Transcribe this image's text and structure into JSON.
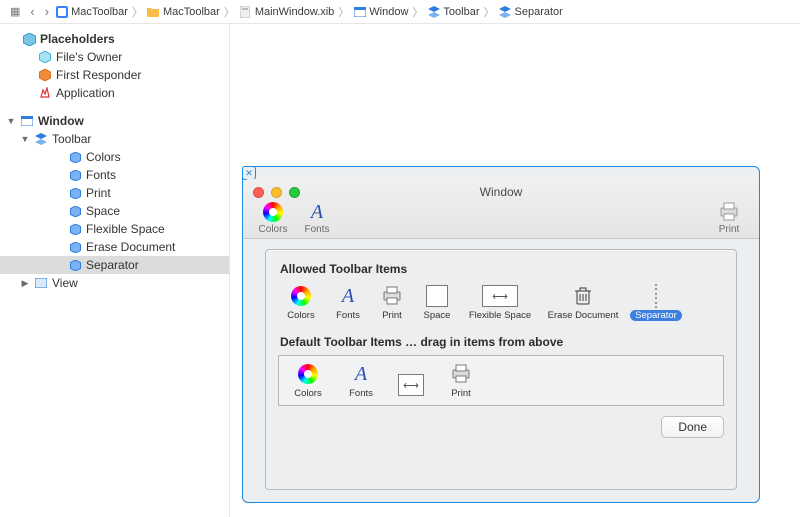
{
  "breadcrumb": [
    {
      "icon": "proj",
      "label": "MacToolbar"
    },
    {
      "icon": "folder",
      "label": "MacToolbar"
    },
    {
      "icon": "xib",
      "label": "MainWindow.xib"
    },
    {
      "icon": "window",
      "label": "Window"
    },
    {
      "icon": "toolbar",
      "label": "Toolbar"
    },
    {
      "icon": "toolbar",
      "label": "Separator"
    }
  ],
  "sidebar": {
    "placeholders_title": "Placeholders",
    "placeholders": [
      {
        "name": "File's Owner",
        "icon": "cube-cyan"
      },
      {
        "name": "First Responder",
        "icon": "cube-red"
      },
      {
        "name": "Application",
        "icon": "app"
      }
    ],
    "objects": {
      "window": "Window",
      "toolbar": "Toolbar",
      "children": [
        "Colors",
        "Fonts",
        "Print",
        "Space",
        "Flexible Space",
        "Erase Document",
        "Separator"
      ],
      "view": "View",
      "selected": "Separator"
    }
  },
  "window": {
    "title": "Window",
    "toolbar_left": [
      {
        "name": "Colors",
        "icon": "wheel"
      },
      {
        "name": "Fonts",
        "icon": "A"
      }
    ],
    "toolbar_right": {
      "name": "Print",
      "icon": "printer"
    }
  },
  "panel": {
    "allowed_title": "Allowed Toolbar Items",
    "allowed": [
      {
        "name": "Colors",
        "icon": "wheel"
      },
      {
        "name": "Fonts",
        "icon": "A"
      },
      {
        "name": "Print",
        "icon": "printer"
      },
      {
        "name": "Space",
        "icon": "box"
      },
      {
        "name": "Flexible Space",
        "icon": "flexbox"
      },
      {
        "name": "Erase Document",
        "icon": "trash"
      },
      {
        "name": "Separator",
        "icon": "sepdots",
        "selected": true
      }
    ],
    "default_title": "Default Toolbar Items … drag in items from above",
    "defaults": [
      {
        "name": "Colors",
        "icon": "wheel"
      },
      {
        "name": "Fonts",
        "icon": "A"
      },
      {
        "name": "",
        "icon": "flexbox"
      },
      {
        "name": "Print",
        "icon": "printer"
      }
    ],
    "done": "Done"
  }
}
